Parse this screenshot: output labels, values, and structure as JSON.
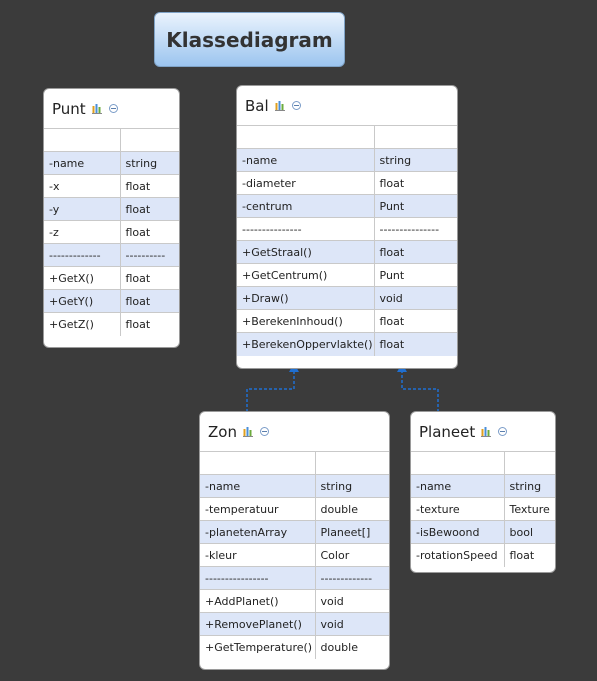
{
  "title": "Klassediagram",
  "classes": {
    "punt": {
      "name": "Punt",
      "rows": [
        {
          "a": "",
          "b": ""
        },
        {
          "a": "-name",
          "b": "string"
        },
        {
          "a": "-x",
          "b": "float"
        },
        {
          "a": "-y",
          "b": "float"
        },
        {
          "a": "-z",
          "b": "float"
        },
        {
          "a": "-------------",
          "b": "----------"
        },
        {
          "a": "+GetX()",
          "b": "float"
        },
        {
          "a": "+GetY()",
          "b": "float"
        },
        {
          "a": "+GetZ()",
          "b": "float"
        }
      ]
    },
    "bal": {
      "name": "Bal",
      "rows": [
        {
          "a": "",
          "b": ""
        },
        {
          "a": "-name",
          "b": "string"
        },
        {
          "a": "-diameter",
          "b": "float"
        },
        {
          "a": "-centrum",
          "b": "Punt"
        },
        {
          "a": "---------------",
          "b": "---------------"
        },
        {
          "a": "+GetStraal()",
          "b": "float"
        },
        {
          "a": "+GetCentrum()",
          "b": "Punt"
        },
        {
          "a": "+Draw()",
          "b": "void"
        },
        {
          "a": "+BerekenInhoud()",
          "b": "float"
        },
        {
          "a": "+BerekenOppervlakte()",
          "b": "float"
        }
      ]
    },
    "zon": {
      "name": "Zon",
      "rows": [
        {
          "a": "",
          "b": ""
        },
        {
          "a": "-name",
          "b": "string"
        },
        {
          "a": "-temperatuur",
          "b": "double"
        },
        {
          "a": "-planetenArray",
          "b": "Planeet[]"
        },
        {
          "a": "-kleur",
          "b": "Color"
        },
        {
          "a": "----------------",
          "b": "-------------"
        },
        {
          "a": "+AddPlanet()",
          "b": "void"
        },
        {
          "a": "+RemovePlanet()",
          "b": "void"
        },
        {
          "a": "+GetTemperature()",
          "b": "double"
        }
      ]
    },
    "planeet": {
      "name": "Planeet",
      "rows": [
        {
          "a": "",
          "b": ""
        },
        {
          "a": "-name",
          "b": "string"
        },
        {
          "a": "-texture",
          "b": "Texture"
        },
        {
          "a": "-isBewoond",
          "b": "bool"
        },
        {
          "a": "-rotationSpeed",
          "b": "float"
        }
      ]
    }
  },
  "colors": {
    "background": "#3b3b3b",
    "row_highlight": "#dde6f8",
    "connector": "#1f6fd1"
  },
  "icons": [
    "attributes-icon",
    "collapse-icon"
  ]
}
